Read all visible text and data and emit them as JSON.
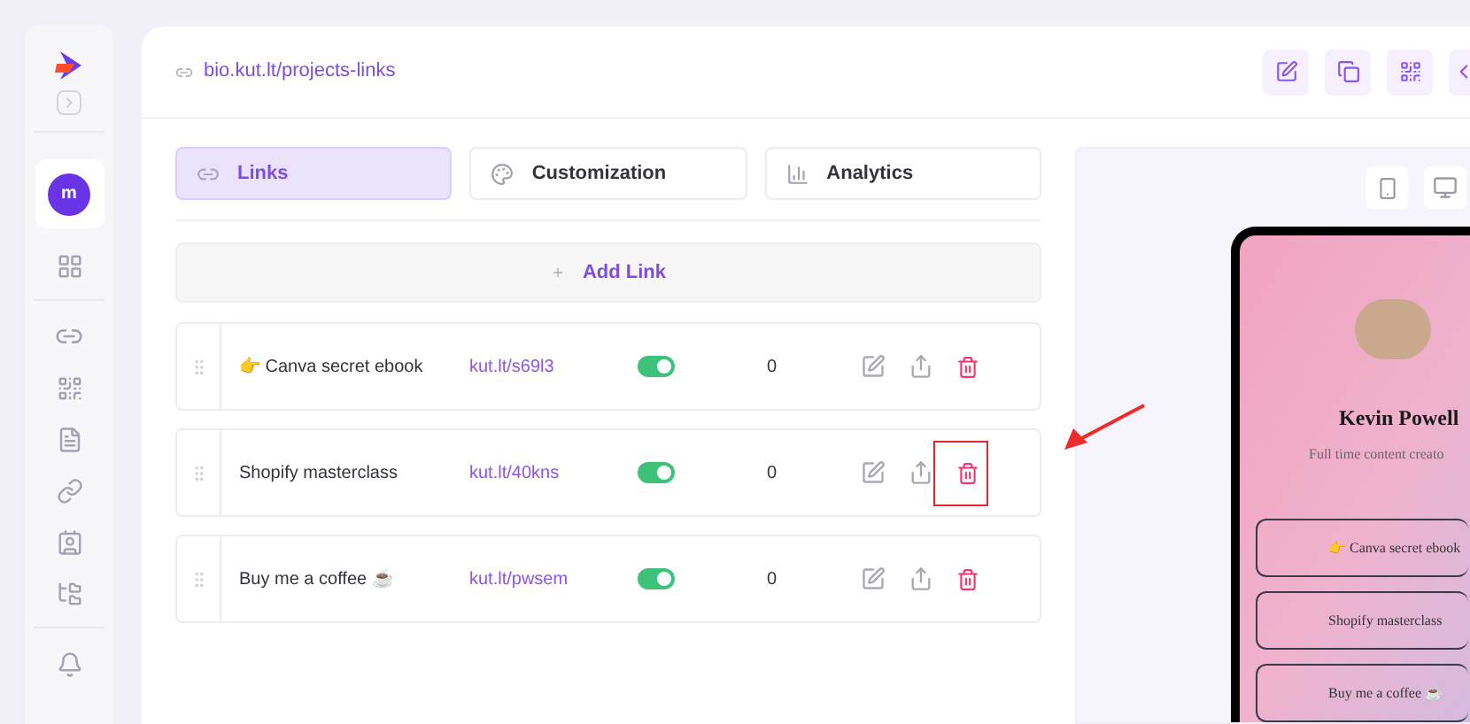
{
  "sidebar": {
    "avatar_letter": "m"
  },
  "header": {
    "url": "bio.kut.lt/projects-links"
  },
  "tabs": [
    {
      "label": "Links",
      "selected": true,
      "kind": "links"
    },
    {
      "label": "Customization",
      "selected": false,
      "kind": "palette"
    },
    {
      "label": "Analytics",
      "selected": false,
      "kind": "chart"
    }
  ],
  "add_link": {
    "label": "Add Link"
  },
  "links": [
    {
      "title": "👉 Canva secret ebook",
      "short_url": "kut.lt/s69l3",
      "on": true,
      "clicks": "0",
      "delete_highlighted": false
    },
    {
      "title": "Shopify masterclass",
      "short_url": "kut.lt/40kns",
      "on": true,
      "clicks": "0",
      "delete_highlighted": true
    },
    {
      "title": "Buy me a coffee ☕",
      "short_url": "kut.lt/pwsem",
      "on": true,
      "clicks": "0",
      "delete_highlighted": false
    }
  ],
  "preview": {
    "name": "Kevin Powell",
    "bio": "Full time content creato",
    "buttons": [
      "👉 Canva secret ebook",
      "Shopify masterclass",
      "Buy me a coffee ☕"
    ]
  }
}
